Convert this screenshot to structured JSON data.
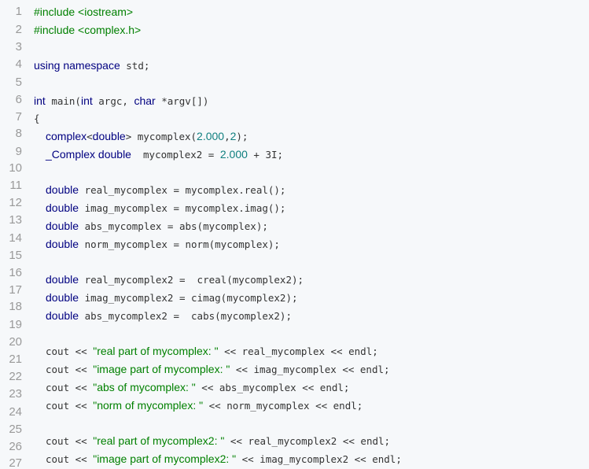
{
  "editor": {
    "line_numbers": [
      "1",
      "2",
      "3",
      "4",
      "5",
      "6",
      "7",
      "8",
      "9",
      "10",
      "11",
      "12",
      "13",
      "14",
      "15",
      "16",
      "17",
      "18",
      "19",
      "20",
      "21",
      "22",
      "23",
      "24",
      "25",
      "26",
      "27"
    ],
    "lines": [
      {
        "indent": false,
        "tokens": [
          {
            "t": "#include <iostream>",
            "c": "pp"
          }
        ]
      },
      {
        "indent": false,
        "tokens": [
          {
            "t": "#include <complex.h>",
            "c": "pp"
          }
        ]
      },
      {
        "indent": false,
        "tokens": []
      },
      {
        "indent": false,
        "tokens": [
          {
            "t": "using",
            "c": "kw"
          },
          {
            "t": " "
          },
          {
            "t": "namespace",
            "c": "kw"
          },
          {
            "t": " std;",
            "c": "mono"
          }
        ]
      },
      {
        "indent": false,
        "tokens": []
      },
      {
        "indent": false,
        "tokens": [
          {
            "t": "int",
            "c": "kw"
          },
          {
            "t": " main(",
            "c": "mono"
          },
          {
            "t": "int",
            "c": "kw"
          },
          {
            "t": " argc, ",
            "c": "mono"
          },
          {
            "t": "char",
            "c": "kw"
          },
          {
            "t": " *argv[])",
            "c": "mono"
          }
        ]
      },
      {
        "indent": false,
        "tokens": [
          {
            "t": "{",
            "c": "mono"
          }
        ]
      },
      {
        "indent": true,
        "tokens": [
          {
            "t": "complex",
            "c": "kw"
          },
          {
            "t": "<",
            "c": "mono"
          },
          {
            "t": "double",
            "c": "kw"
          },
          {
            "t": "> mycomplex(",
            "c": "mono"
          },
          {
            "t": "2.000",
            "c": "num"
          },
          {
            "t": ",",
            "c": "mono"
          },
          {
            "t": "2",
            "c": "num"
          },
          {
            "t": ");",
            "c": "mono"
          }
        ]
      },
      {
        "indent": true,
        "tokens": [
          {
            "t": "_Complex",
            "c": "kw"
          },
          {
            "t": " "
          },
          {
            "t": "double",
            "c": "kw"
          },
          {
            "t": "  mycomplex2 = ",
            "c": "mono"
          },
          {
            "t": "2.000",
            "c": "num"
          },
          {
            "t": " + ",
            "c": "mono"
          },
          {
            "t": "3I",
            "c": "mono"
          },
          {
            "t": ";",
            "c": "mono"
          }
        ]
      },
      {
        "indent": false,
        "tokens": []
      },
      {
        "indent": true,
        "tokens": [
          {
            "t": "double",
            "c": "kw"
          },
          {
            "t": " real_mycomplex = mycomplex.real();",
            "c": "mono"
          }
        ]
      },
      {
        "indent": true,
        "tokens": [
          {
            "t": "double",
            "c": "kw"
          },
          {
            "t": " imag_mycomplex = mycomplex.imag();",
            "c": "mono"
          }
        ]
      },
      {
        "indent": true,
        "tokens": [
          {
            "t": "double",
            "c": "kw"
          },
          {
            "t": " abs_mycomplex = abs(mycomplex);",
            "c": "mono"
          }
        ]
      },
      {
        "indent": true,
        "tokens": [
          {
            "t": "double",
            "c": "kw"
          },
          {
            "t": " norm_mycomplex = norm(mycomplex);",
            "c": "mono"
          }
        ]
      },
      {
        "indent": false,
        "tokens": []
      },
      {
        "indent": true,
        "tokens": [
          {
            "t": "double",
            "c": "kw"
          },
          {
            "t": " real_mycomplex2 =  creal(mycomplex2);",
            "c": "mono"
          }
        ]
      },
      {
        "indent": true,
        "tokens": [
          {
            "t": "double",
            "c": "kw"
          },
          {
            "t": " imag_mycomplex2 = cimag(mycomplex2);",
            "c": "mono"
          }
        ]
      },
      {
        "indent": true,
        "tokens": [
          {
            "t": "double",
            "c": "kw"
          },
          {
            "t": " abs_mycomplex2 =  cabs(mycomplex2);",
            "c": "mono"
          }
        ]
      },
      {
        "indent": false,
        "tokens": []
      },
      {
        "indent": true,
        "tokens": [
          {
            "t": "cout << ",
            "c": "mono"
          },
          {
            "t": "\"real part of mycomplex: \"",
            "c": "str"
          },
          {
            "t": " << real_mycomplex << endl;",
            "c": "mono"
          }
        ]
      },
      {
        "indent": true,
        "tokens": [
          {
            "t": "cout << ",
            "c": "mono"
          },
          {
            "t": "\"image part of mycomplex: \"",
            "c": "str"
          },
          {
            "t": " << imag_mycomplex << endl;",
            "c": "mono"
          }
        ]
      },
      {
        "indent": true,
        "tokens": [
          {
            "t": "cout << ",
            "c": "mono"
          },
          {
            "t": "\"abs of mycomplex: \"",
            "c": "str"
          },
          {
            "t": " << abs_mycomplex << endl;",
            "c": "mono"
          }
        ]
      },
      {
        "indent": true,
        "tokens": [
          {
            "t": "cout << ",
            "c": "mono"
          },
          {
            "t": "\"norm of mycomplex: \"",
            "c": "str"
          },
          {
            "t": " << norm_mycomplex << endl;",
            "c": "mono"
          }
        ]
      },
      {
        "indent": false,
        "tokens": []
      },
      {
        "indent": true,
        "tokens": [
          {
            "t": "cout << ",
            "c": "mono"
          },
          {
            "t": "\"real part of mycomplex2: \"",
            "c": "str"
          },
          {
            "t": " << real_mycomplex2 << endl;",
            "c": "mono"
          }
        ]
      },
      {
        "indent": true,
        "tokens": [
          {
            "t": "cout << ",
            "c": "mono"
          },
          {
            "t": "\"image part of mycomplex2: \"",
            "c": "str"
          },
          {
            "t": " << imag_mycomplex2 << endl;",
            "c": "mono"
          }
        ]
      }
    ],
    "colors": {
      "background": "#f6f8fa",
      "keyword": "#000080",
      "preprocessor": "#008000",
      "string": "#008000",
      "number": "#0f7f7f",
      "line_number": "#999999"
    }
  }
}
